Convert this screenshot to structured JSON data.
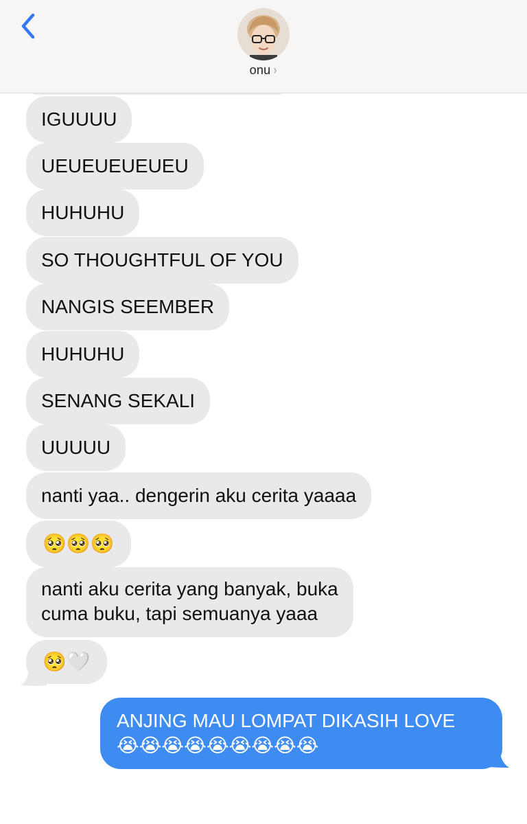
{
  "header": {
    "contact_name": "onu",
    "contact_chevron": "›",
    "back_icon": "chevron-left-icon",
    "accent_color": "#3478f6"
  },
  "messages": [
    {
      "side": "received",
      "text": "IGUUUU"
    },
    {
      "side": "received",
      "text": "UEUEUEUEUEU"
    },
    {
      "side": "received",
      "text": "HUHUHU"
    },
    {
      "side": "received",
      "text": "SO THOUGHTFUL OF YOU"
    },
    {
      "side": "received",
      "text": "NANGIS SEEMBER"
    },
    {
      "side": "received",
      "text": "HUHUHU"
    },
    {
      "side": "received",
      "text": "SENANG SEKALI"
    },
    {
      "side": "received",
      "text": "UUUUU"
    },
    {
      "side": "received",
      "text": "nanti yaa.. dengerin aku cerita yaaaa"
    },
    {
      "side": "received",
      "text": "🥺🥺🥺"
    },
    {
      "side": "received",
      "line1": "nanti aku cerita yang banyak, buka",
      "line2": "cuma buku, tapi semuanya yaaa"
    },
    {
      "side": "received",
      "text": "🥺🤍"
    },
    {
      "side": "sent",
      "line1": "ANJING MAU LOMPAT DIKASIH LOVE",
      "line2": "😭😭😭😭😭😭😭😭😭"
    }
  ],
  "colors": {
    "received_bubble": "#e9e9eb",
    "sent_bubble": "#3e8bf2",
    "header_bg": "#f7f6f4"
  }
}
